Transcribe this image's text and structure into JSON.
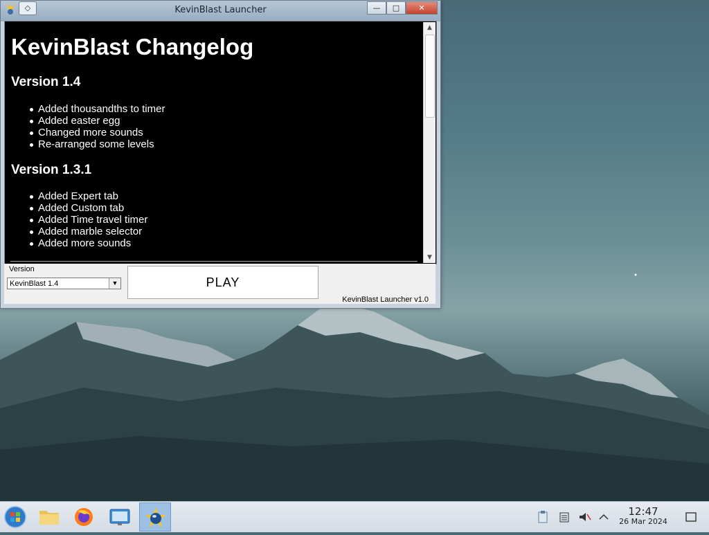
{
  "window": {
    "title": "KevinBlast Launcher",
    "pin_glyph": "◇",
    "minimize_glyph": "—",
    "maximize_glyph": "□",
    "close_glyph": "✕"
  },
  "changelog": {
    "title": "KevinBlast Changelog",
    "versions": [
      {
        "heading": "Version 1.4",
        "changes": [
          "Added thousandths to timer",
          "Added easter egg",
          "Changed more sounds",
          "Re-arranged some levels"
        ]
      },
      {
        "heading": "Version 1.3.1",
        "changes": [
          "Added Expert tab",
          "Added Custom tab",
          "Added Time travel timer",
          "Added marble selector",
          "Added more sounds"
        ]
      }
    ]
  },
  "bottom": {
    "version_label": "Version",
    "selected_version": "KevinBlast 1.4",
    "play_label": "PLAY",
    "launcher_version": "KevinBlast Launcher v1.0"
  },
  "taskbar": {
    "items": [
      "start-menu-icon",
      "file-manager-icon",
      "firefox-icon",
      "control-panel-icon",
      "kevinblast-icon"
    ],
    "tray": [
      "clipboard-icon",
      "notes-icon",
      "volume-muted-icon",
      "show-hidden-icons-chevron-icon"
    ],
    "clock_time": "12:47",
    "clock_date": "26 Mar 2024"
  },
  "colors": {
    "changelog_bg": "#000000",
    "changelog_text": "#ffffff",
    "taskbar_active": "#9cc0e4",
    "close_button": "#c4442e"
  }
}
